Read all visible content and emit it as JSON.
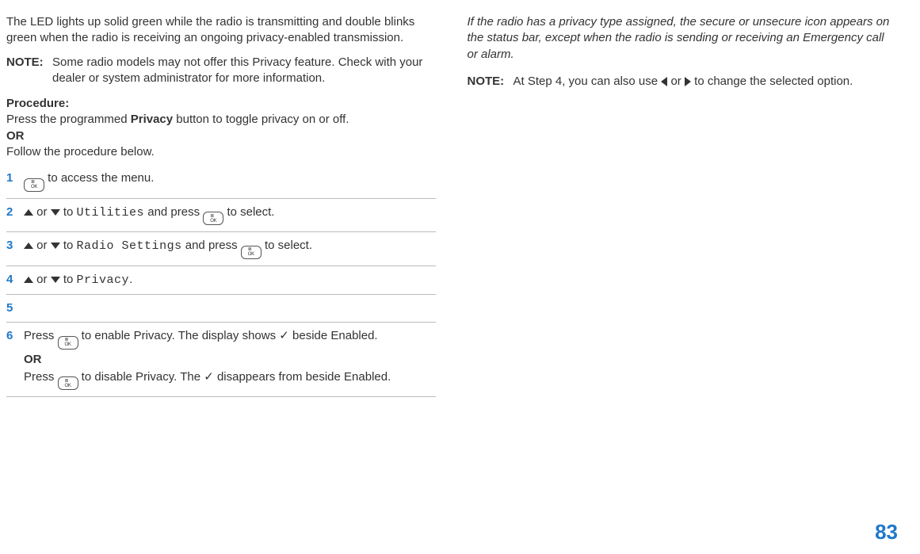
{
  "col1": {
    "intro": "The LED lights up solid green while the radio is transmitting and double blinks green when the radio is receiving an ongoing privacy-enabled transmission.",
    "note_label": "NOTE:",
    "note_text": "Some radio models may not offer this Privacy feature. Check with your dealer or system administrator for more information.",
    "procedure_label": "Procedure:",
    "proc_line1a": "Press the programmed ",
    "proc_line1b": "Privacy",
    "proc_line1c": " button to toggle privacy on or off.",
    "or": "OR",
    "proc_line2": "Follow the procedure below.",
    "steps": {
      "s1": {
        "num": "1",
        "tail": " to access the menu."
      },
      "s2": {
        "num": "2",
        "mid": " or ",
        "to": " to ",
        "menu": "Utilities",
        "and": " and press ",
        "sel": " to select."
      },
      "s3": {
        "num": "3",
        "mid": " or ",
        "to": " to ",
        "menu": "Radio Settings",
        "and": " and press ",
        "sel": " to select."
      },
      "s4": {
        "num": "4",
        "mid": " or ",
        "to": " to ",
        "menu": "Privacy",
        "dot": "."
      },
      "s5": {
        "num": "5"
      },
      "s6": {
        "num": "6",
        "a1": "Press ",
        "a2": " to enable Privacy. The display shows ",
        "check": "✓",
        "a3": " beside Enabled.",
        "or": "OR",
        "b1": "Press ",
        "b2": " to disable Privacy. The ",
        "b3": " disappears from beside Enabled."
      }
    }
  },
  "col2": {
    "italic_para": "If the radio has a privacy type assigned, the  secure or unsecure icon appears on the status bar, except when the radio is sending or receiving an Emergency call or alarm.",
    "note_label": "NOTE:",
    "note_a": "At Step 4, you can also use ",
    "note_mid": " or ",
    "note_b": " to change the selected option."
  },
  "page_number": "83"
}
